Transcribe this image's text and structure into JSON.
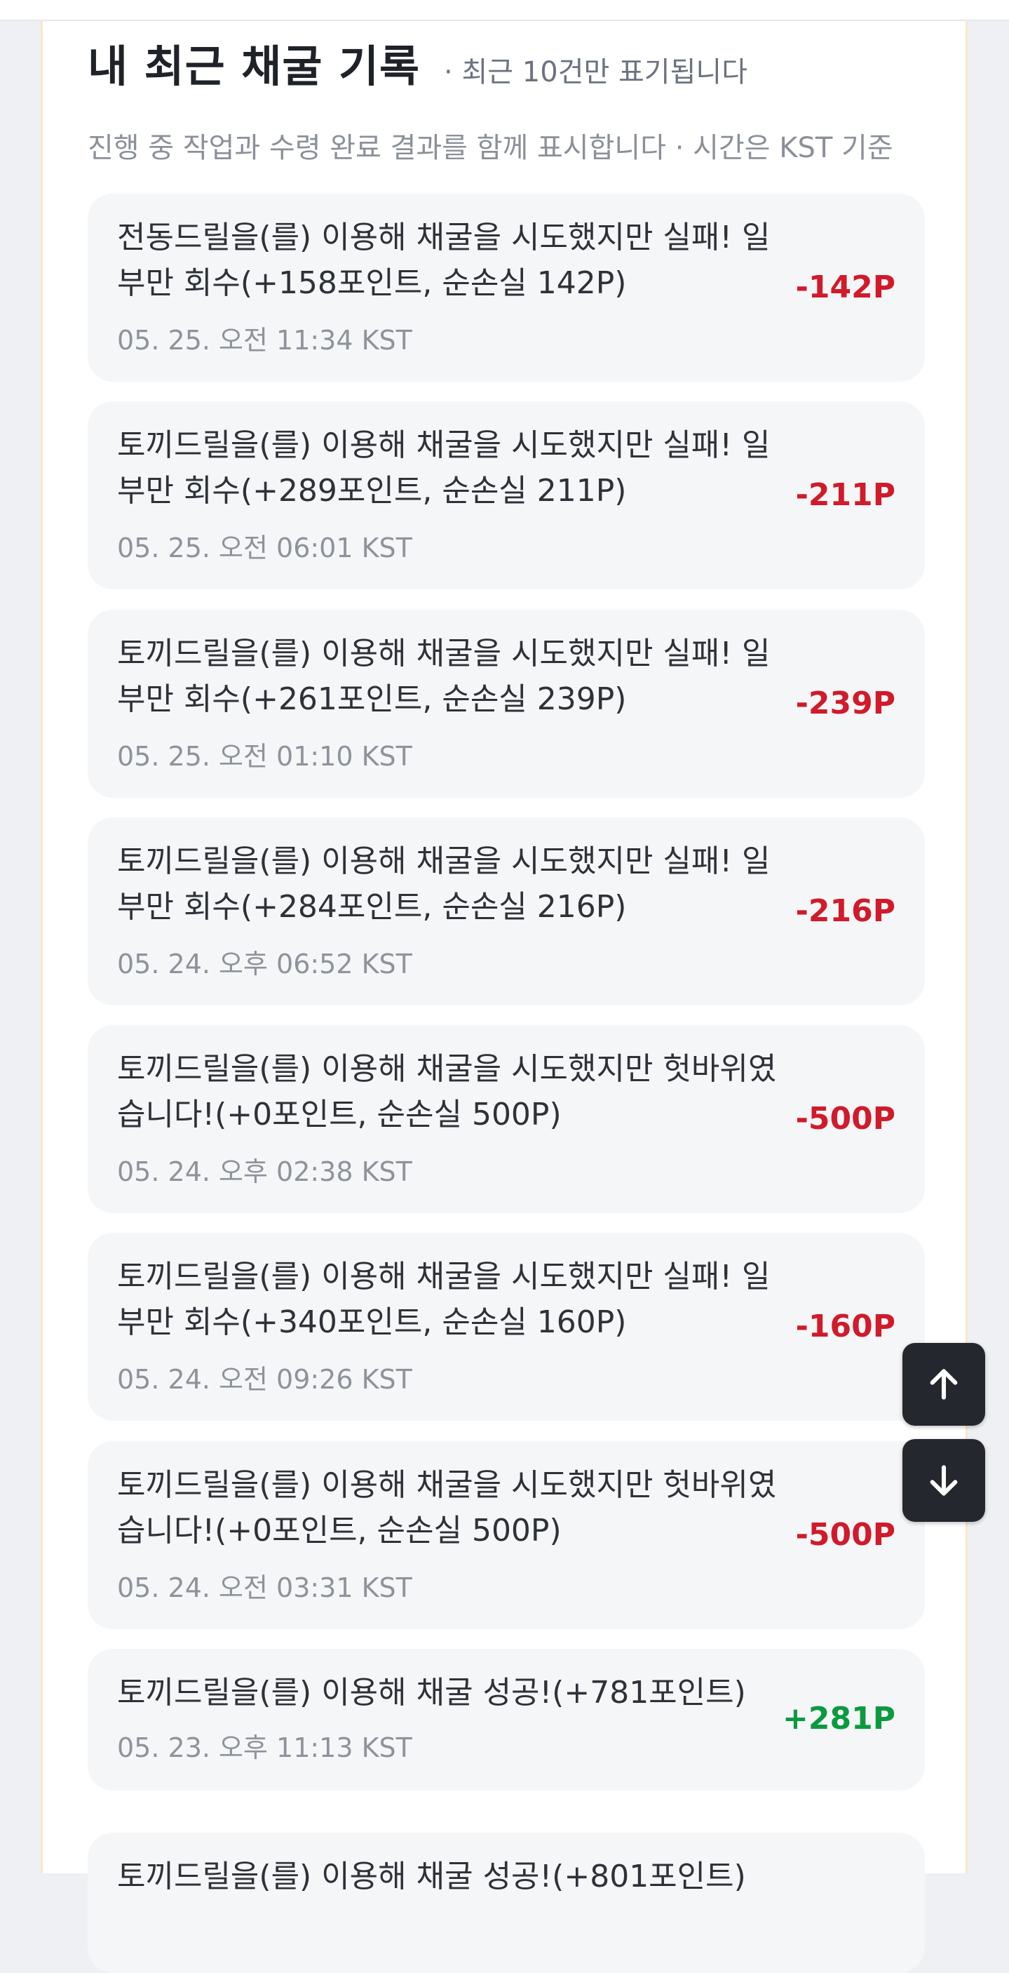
{
  "header": {
    "title": "내 최근 채굴 기록",
    "note": "· 최근 10건만 표기됩니다",
    "subtitle": "진행 중 작업과 수령 완료 결과를 함께 표시합니다 · 시간은 KST 기준"
  },
  "records": [
    {
      "text": "전동드릴을(를) 이용해 채굴을 시도했지만 실패! 일부만 회수(+158포인트, 순손실 142P)",
      "time": "05. 25. 오전 11:34 KST",
      "amount": "-142P",
      "type": "loss"
    },
    {
      "text": "토끼드릴을(를) 이용해 채굴을 시도했지만 실패! 일부만 회수(+289포인트, 순손실 211P)",
      "time": "05. 25. 오전 06:01 KST",
      "amount": "-211P",
      "type": "loss"
    },
    {
      "text": "토끼드릴을(를) 이용해 채굴을 시도했지만 실패! 일부만 회수(+261포인트, 순손실 239P)",
      "time": "05. 25. 오전 01:10 KST",
      "amount": "-239P",
      "type": "loss"
    },
    {
      "text": "토끼드릴을(를) 이용해 채굴을 시도했지만 실패! 일부만 회수(+284포인트, 순손실 216P)",
      "time": "05. 24. 오후 06:52 KST",
      "amount": "-216P",
      "type": "loss"
    },
    {
      "text": "토끼드릴을(를) 이용해 채굴을 시도했지만 헛바위였습니다!(+0포인트, 순손실 500P)",
      "time": "05. 24. 오후 02:38 KST",
      "amount": "-500P",
      "type": "loss"
    },
    {
      "text": "토끼드릴을(를) 이용해 채굴을 시도했지만 실패! 일부만 회수(+340포인트, 순손실 160P)",
      "time": "05. 24. 오전 09:26 KST",
      "amount": "-160P",
      "type": "loss"
    },
    {
      "text": "토끼드릴을(를) 이용해 채굴을 시도했지만 헛바위였습니다!(+0포인트, 순손실 500P)",
      "time": "05. 24. 오전 03:31 KST",
      "amount": "-500P",
      "type": "loss"
    },
    {
      "text": "토끼드릴을(를) 이용해 채굴 성공!(+781포인트)",
      "time": "05. 23. 오후 11:13 KST",
      "amount": "+281P",
      "type": "gain"
    },
    {
      "text": "토끼드릴을(를) 이용해 채굴 성공!(+801포인트)",
      "time": "",
      "amount": "",
      "type": "gain"
    }
  ],
  "colors": {
    "loss": "#d11a2a",
    "gain": "#0c9a3f",
    "fab_bg": "#24272d"
  },
  "icons": {
    "scroll_up": "arrow-up-icon",
    "scroll_down": "arrow-down-icon"
  }
}
